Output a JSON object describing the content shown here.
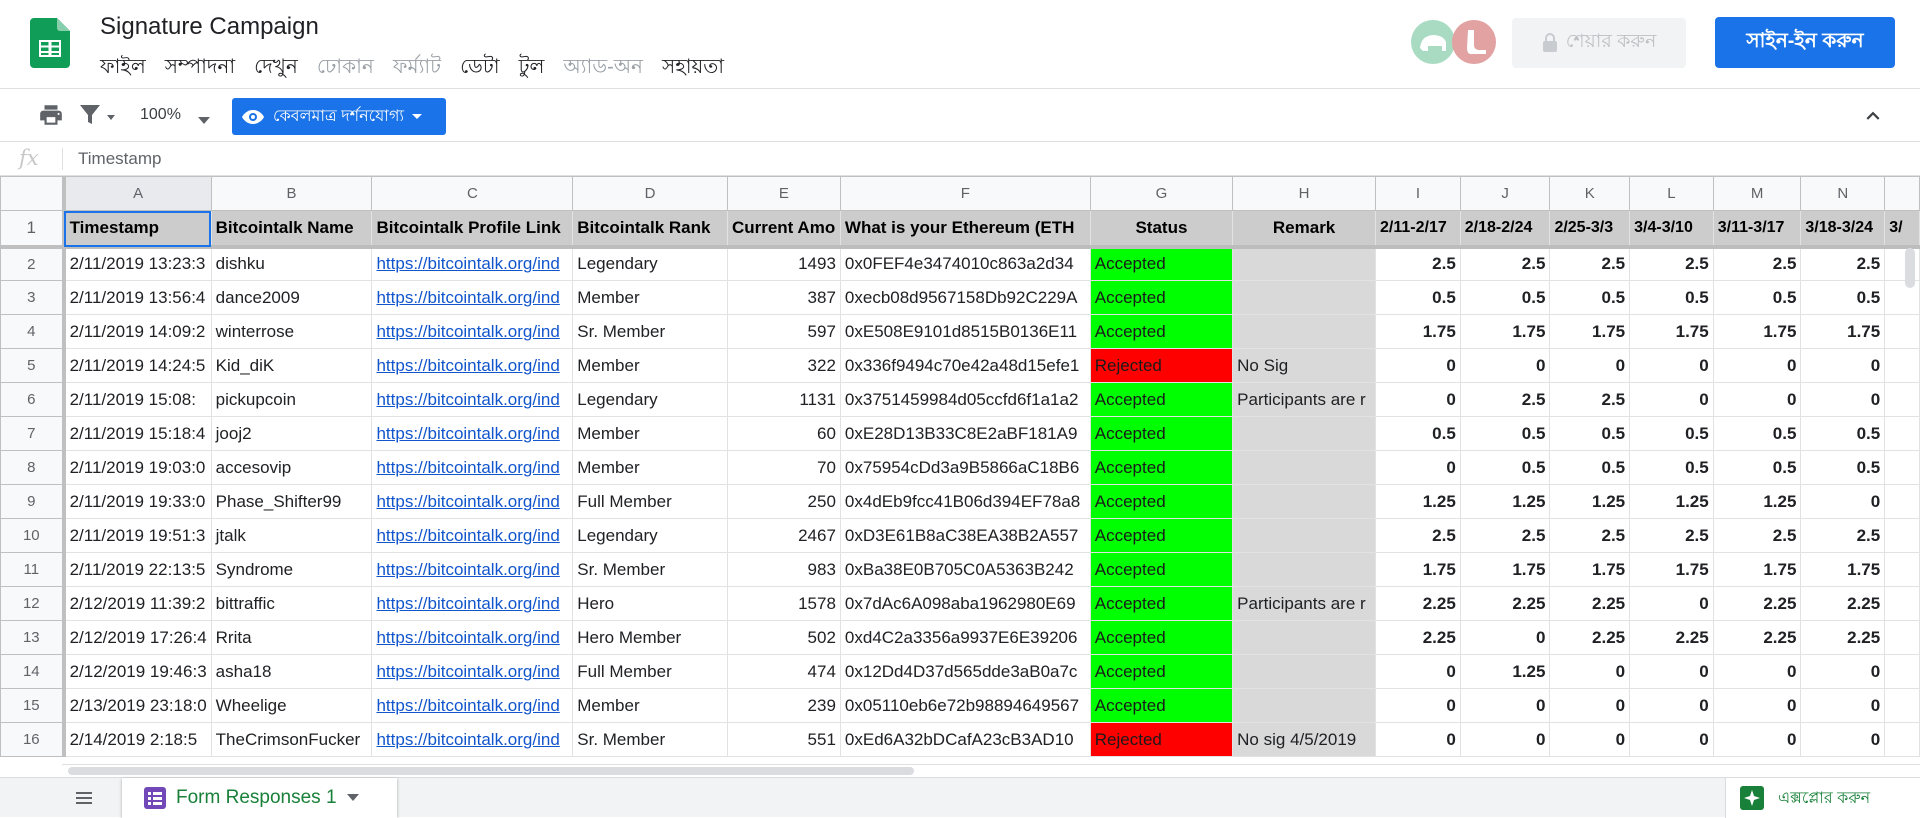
{
  "app": {
    "title": "Signature Campaign",
    "menu": [
      {
        "label": "ফাইল",
        "enabled": true
      },
      {
        "label": "সম্পাদনা",
        "enabled": true
      },
      {
        "label": "দেখুন",
        "enabled": true
      },
      {
        "label": "ঢোকান",
        "enabled": false
      },
      {
        "label": "ফর্ম্যাট",
        "enabled": false
      },
      {
        "label": "ডেটা",
        "enabled": true
      },
      {
        "label": "টুল",
        "enabled": true
      },
      {
        "label": "অ্যাড-অন",
        "enabled": false
      },
      {
        "label": "সহায়তা",
        "enabled": true
      }
    ],
    "share_label": "শেয়ার করুন",
    "sign_in_label": "সাইন-ইন করুন",
    "accent_color": "#1a73e8",
    "sheets_green": "#188038"
  },
  "toolbar": {
    "zoom": "100%",
    "view_only_label": "কেবলমাত্র দর্শনযোগ্য"
  },
  "formula_bar": {
    "fx": "fx",
    "content": "Timestamp"
  },
  "grid": {
    "column_letters": [
      "A",
      "B",
      "C",
      "D",
      "E",
      "F",
      "G",
      "H",
      "I",
      "J",
      "K",
      "L",
      "M",
      "N"
    ],
    "header_row": {
      "row_number": "1",
      "cells": [
        "Timestamp",
        "Bitcointalk Name",
        "Bitcointalk Profile Link",
        "Bitcointalk Rank",
        "Current Amo",
        "What is your Ethereum (ETH",
        "Status",
        "Remark",
        "2/11-2/17",
        "2/18-2/24",
        "2/25-3/3",
        "3/4-3/10",
        "3/11-3/17",
        "3/18-3/24",
        "3/"
      ]
    },
    "rows": [
      {
        "n": "2",
        "timestamp": "2/11/2019 13:23:3",
        "name": "dishku",
        "link": "https://bitcointalk.org/ind",
        "rank": "Legendary",
        "amount": "1493",
        "eth": "0x0FEF4e3474010c863a2d34",
        "status": "Accepted",
        "remark": "",
        "weeks": [
          "2.5",
          "2.5",
          "2.5",
          "2.5",
          "2.5",
          "2.5"
        ]
      },
      {
        "n": "3",
        "timestamp": "2/11/2019 13:56:4",
        "name": "dance2009",
        "link": "https://bitcointalk.org/ind",
        "rank": "Member",
        "amount": "387",
        "eth": "0xecb08d9567158Db92C229A",
        "status": "Accepted",
        "remark": "",
        "weeks": [
          "0.5",
          "0.5",
          "0.5",
          "0.5",
          "0.5",
          "0.5"
        ]
      },
      {
        "n": "4",
        "timestamp": "2/11/2019 14:09:2",
        "name": "winterrose",
        "link": "https://bitcointalk.org/ind",
        "rank": "Sr. Member",
        "amount": "597",
        "eth": "0xE508E9101d8515B0136E11",
        "status": "Accepted",
        "remark": "",
        "weeks": [
          "1.75",
          "1.75",
          "1.75",
          "1.75",
          "1.75",
          "1.75"
        ]
      },
      {
        "n": "5",
        "timestamp": "2/11/2019 14:24:5",
        "name": "Kid_diK",
        "link": "https://bitcointalk.org/ind",
        "rank": "Member",
        "amount": "322",
        "eth": "0x336f9494c70e42a48d15efe1",
        "status": "Rejected",
        "remark": "No Sig",
        "weeks": [
          "0",
          "0",
          "0",
          "0",
          "0",
          "0"
        ]
      },
      {
        "n": "6",
        "timestamp": "2/11/2019 15:08:",
        "name": "pickupcoin",
        "link": "https://bitcointalk.org/ind",
        "rank": "Legendary",
        "amount": "1131",
        "eth": "0x3751459984d05ccfd6f1a1a2",
        "status": "Accepted",
        "remark": "Participants are r",
        "weeks": [
          "0",
          "2.5",
          "2.5",
          "0",
          "0",
          "0"
        ]
      },
      {
        "n": "7",
        "timestamp": "2/11/2019 15:18:4",
        "name": "jooj2",
        "link": "https://bitcointalk.org/ind",
        "rank": "Member",
        "amount": "60",
        "eth": "0xE28D13B33C8E2aBF181A9",
        "status": "Accepted",
        "remark": "",
        "weeks": [
          "0.5",
          "0.5",
          "0.5",
          "0.5",
          "0.5",
          "0.5"
        ]
      },
      {
        "n": "8",
        "timestamp": "2/11/2019 19:03:0",
        "name": "accesovip",
        "link": "https://bitcointalk.org/ind",
        "rank": "Member",
        "amount": "70",
        "eth": "0x75954cDd3a9B5866aC18B6",
        "status": "Accepted",
        "remark": "",
        "weeks": [
          "0",
          "0.5",
          "0.5",
          "0.5",
          "0.5",
          "0.5"
        ]
      },
      {
        "n": "9",
        "timestamp": "2/11/2019 19:33:0",
        "name": "Phase_Shifter99",
        "link": "https://bitcointalk.org/ind",
        "rank": "Full Member",
        "amount": "250",
        "eth": "0x4dEb9fcc41B06d394EF78a8",
        "status": "Accepted",
        "remark": "",
        "weeks": [
          "1.25",
          "1.25",
          "1.25",
          "1.25",
          "1.25",
          "0"
        ]
      },
      {
        "n": "10",
        "timestamp": "2/11/2019 19:51:3",
        "name": "jtalk",
        "link": "https://bitcointalk.org/ind",
        "rank": "Legendary",
        "amount": "2467",
        "eth": "0xD3E61B8aC38EA38B2A557",
        "status": "Accepted",
        "remark": "",
        "weeks": [
          "2.5",
          "2.5",
          "2.5",
          "2.5",
          "2.5",
          "2.5"
        ]
      },
      {
        "n": "11",
        "timestamp": "2/11/2019 22:13:5",
        "name": "Syndrome",
        "link": "https://bitcointalk.org/ind",
        "rank": "Sr. Member",
        "amount": "983",
        "eth": "0xBa38E0B705C0A5363B242",
        "status": "Accepted",
        "remark": "",
        "weeks": [
          "1.75",
          "1.75",
          "1.75",
          "1.75",
          "1.75",
          "1.75"
        ]
      },
      {
        "n": "12",
        "timestamp": "2/12/2019 11:39:2",
        "name": "bittraffic",
        "link": "https://bitcointalk.org/ind",
        "rank": "Hero",
        "amount": "1578",
        "eth": "0x7dAc6A098aba1962980E69",
        "status": "Accepted",
        "remark": "Participants are r",
        "weeks": [
          "2.25",
          "2.25",
          "2.25",
          "0",
          "2.25",
          "2.25"
        ]
      },
      {
        "n": "13",
        "timestamp": "2/12/2019 17:26:4",
        "name": "Rrita",
        "link": "https://bitcointalk.org/ind",
        "rank": "Hero Member",
        "amount": "502",
        "eth": "0xd4C2a3356a9937E6E39206",
        "status": "Accepted",
        "remark": "",
        "weeks": [
          "2.25",
          "0",
          "2.25",
          "2.25",
          "2.25",
          "2.25"
        ]
      },
      {
        "n": "14",
        "timestamp": "2/12/2019 19:46:3",
        "name": "asha18",
        "link": "https://bitcointalk.org/ind",
        "rank": "Full Member",
        "amount": "474",
        "eth": "0x12Dd4D37d565dde3aB0a7c",
        "status": "Accepted",
        "remark": "",
        "weeks": [
          "0",
          "1.25",
          "0",
          "0",
          "0",
          "0"
        ]
      },
      {
        "n": "15",
        "timestamp": "2/13/2019 23:18:0",
        "name": "Wheelige",
        "link": "https://bitcointalk.org/ind",
        "rank": "Member",
        "amount": "239",
        "eth": "0x05110eb6e72b98894649567",
        "status": "Accepted",
        "remark": "",
        "weeks": [
          "0",
          "0",
          "0",
          "0",
          "0",
          "0"
        ]
      },
      {
        "n": "16",
        "timestamp": "2/14/2019 2:18:5",
        "name": "TheCrimsonFucker",
        "link": "https://bitcointalk.org/ind",
        "rank": "Sr. Member",
        "amount": "551",
        "eth": "0xEd6A32bDCafA23cB3AD10",
        "status": "Rejected",
        "remark": "No sig 4/5/2019",
        "weeks": [
          "0",
          "0",
          "0",
          "0",
          "0",
          "0"
        ]
      }
    ]
  },
  "sheetbar": {
    "tab_label": "Form Responses 1",
    "explore_label": "এক্সপ্লোর করুন"
  }
}
